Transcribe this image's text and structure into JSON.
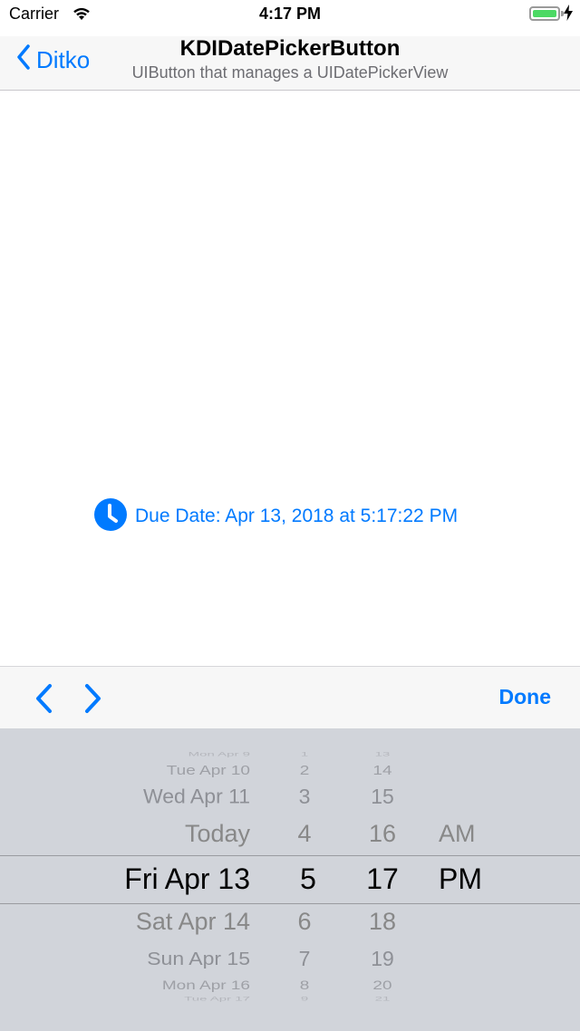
{
  "status_bar": {
    "carrier": "Carrier",
    "time": "4:17 PM"
  },
  "nav": {
    "back_label": "Ditko",
    "title": "KDIDatePickerButton",
    "subtitle": "UIButton that manages a UIDatePickerView"
  },
  "due_button": {
    "icon": "clock-icon",
    "label": "Due Date: Apr 13, 2018 at 5:17:22 PM"
  },
  "toolbar": {
    "prev_icon": "chevron-left-icon",
    "next_icon": "chevron-right-icon",
    "done_label": "Done"
  },
  "picker": {
    "date_column": [
      "Mon Apr 9",
      "Tue Apr 10",
      "Wed Apr 11",
      "Today",
      "Fri Apr 13",
      "Sat Apr 14",
      "Sun Apr 15",
      "Mon Apr 16",
      "Tue Apr 17"
    ],
    "hour_column": [
      "1",
      "2",
      "3",
      "4",
      "5",
      "6",
      "7",
      "8",
      "9"
    ],
    "minute_column": [
      "13",
      "14",
      "15",
      "16",
      "17",
      "18",
      "19",
      "20",
      "21"
    ],
    "ampm_column": [
      "AM",
      "PM"
    ],
    "selected": {
      "date": "Fri Apr 13",
      "hour": "5",
      "minute": "17",
      "ampm": "PM"
    }
  },
  "colors": {
    "accent": "#007aff",
    "picker_background": "#d1d4da",
    "toolbar_background": "#f7f7f7",
    "battery": "#4cd964"
  }
}
